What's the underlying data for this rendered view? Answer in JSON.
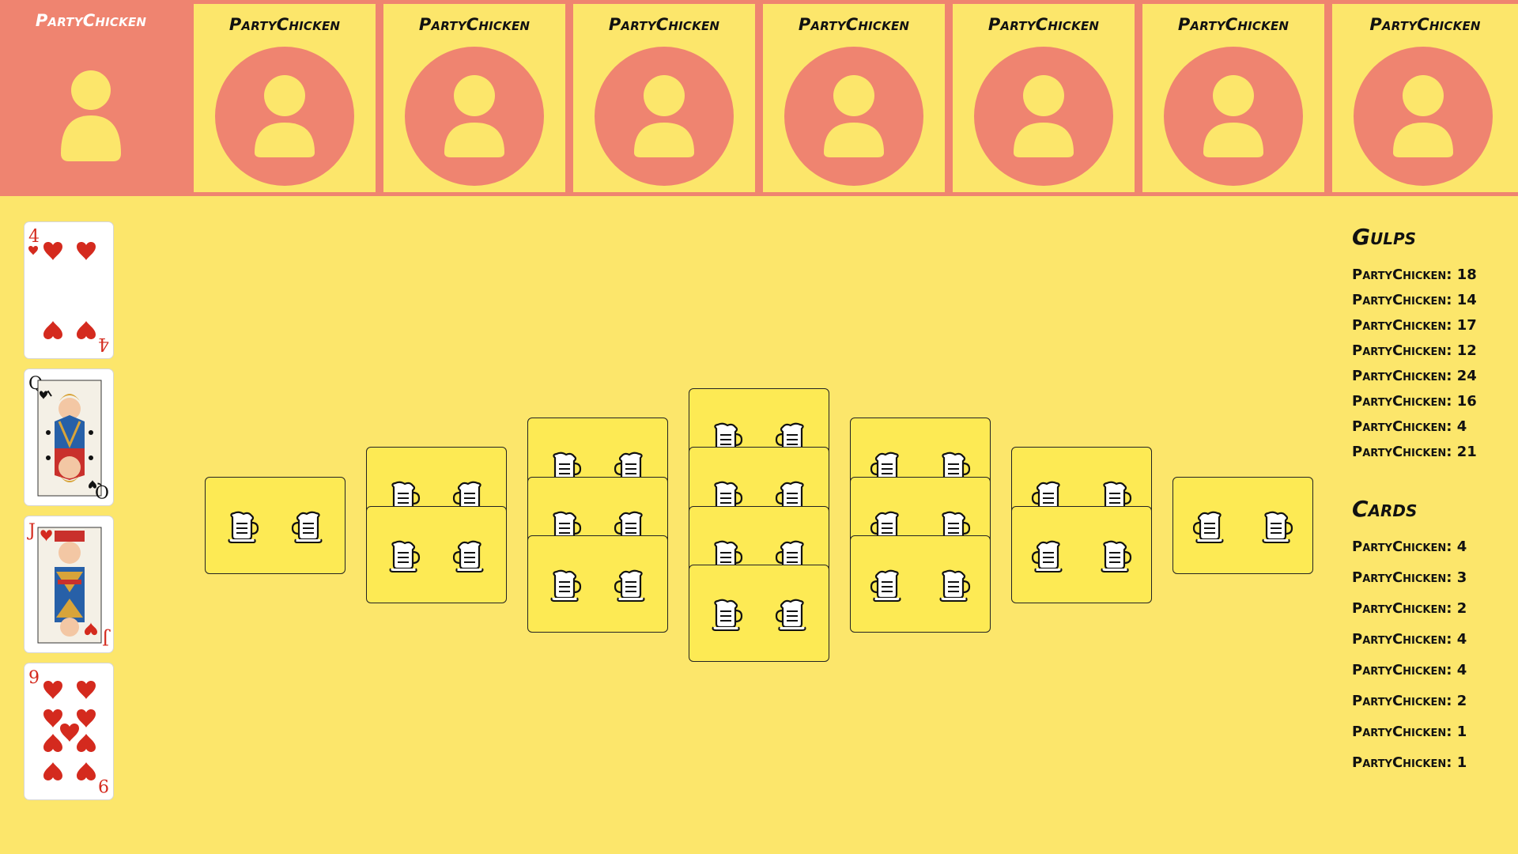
{
  "players": [
    {
      "name": "PartyChicken",
      "active": true
    },
    {
      "name": "PartyChicken",
      "active": false
    },
    {
      "name": "PartyChicken",
      "active": false
    },
    {
      "name": "PartyChicken",
      "active": false
    },
    {
      "name": "PartyChicken",
      "active": false
    },
    {
      "name": "PartyChicken",
      "active": false
    },
    {
      "name": "PartyChicken",
      "active": false
    },
    {
      "name": "PartyChicken",
      "active": false
    }
  ],
  "hand": [
    {
      "rank": "4",
      "suit": "hearts",
      "color": "red"
    },
    {
      "rank": "Q",
      "suit": "spades",
      "color": "black"
    },
    {
      "rank": "J",
      "suit": "hearts",
      "color": "red"
    },
    {
      "rank": "9",
      "suit": "hearts",
      "color": "red"
    }
  ],
  "table": {
    "columns": [
      1,
      2,
      3,
      4,
      3,
      2,
      1
    ],
    "card_icon": "beer-mug-icon",
    "card_count": 16
  },
  "gulps": {
    "title": "Gulps",
    "lines": [
      "PartyChicken: 18",
      "PartyChicken: 14",
      "PartyChicken: 17",
      "PartyChicken: 12",
      "PartyChicken: 24",
      "PartyChicken: 16",
      "PartyChicken: 4",
      "PartyChicken: 21"
    ]
  },
  "cards": {
    "title": "Cards",
    "lines": [
      "PartyChicken: 4",
      "PartyChicken: 3",
      "PartyChicken: 2",
      "PartyChicken: 4",
      "PartyChicken: 4",
      "PartyChicken: 2",
      "PartyChicken: 1",
      "PartyChicken: 1"
    ]
  },
  "colors": {
    "background": "#fce66b",
    "accent": "#ef8470",
    "table_card": "#fdea54",
    "heart": "#d42a1e"
  }
}
